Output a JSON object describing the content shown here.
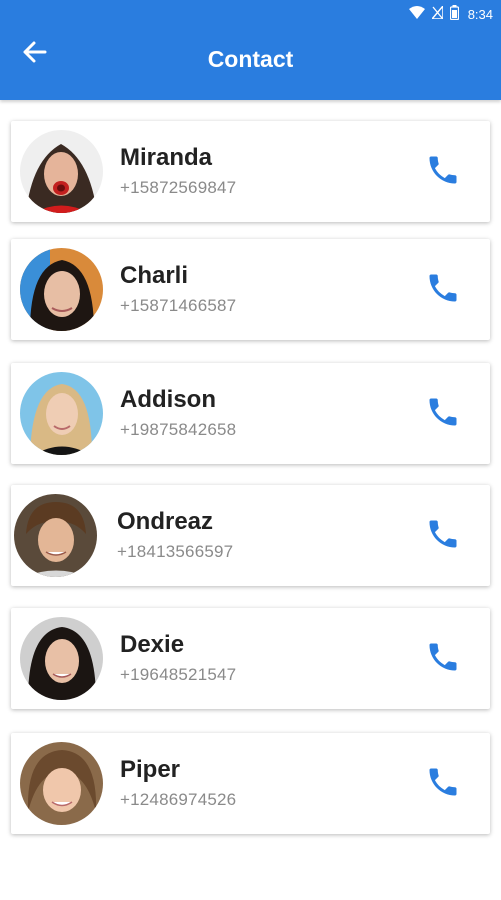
{
  "status_bar": {
    "time": "8:34",
    "icons": [
      "wifi-icon",
      "signal-icon",
      "battery-icon"
    ]
  },
  "app_bar": {
    "title": "Contact",
    "back_icon": "arrow-left-icon",
    "background_color": "#2a7ddf"
  },
  "contacts": [
    {
      "name": "Miranda",
      "phone": "+15872569847",
      "call_icon": "phone-icon"
    },
    {
      "name": "Charli",
      "phone": "+15871466587",
      "call_icon": "phone-icon"
    },
    {
      "name": "Addison",
      "phone": "+19875842658",
      "call_icon": "phone-icon"
    },
    {
      "name": "Ondreaz",
      "phone": "+18413566597",
      "call_icon": "phone-icon"
    },
    {
      "name": "Dexie",
      "phone": "+19648521547",
      "call_icon": "phone-icon"
    },
    {
      "name": "Piper",
      "phone": "+12486974526",
      "call_icon": "phone-icon"
    }
  ],
  "colors": {
    "accent": "#2a7ddf",
    "name_text": "#222222",
    "phone_text": "#8a8a8a"
  }
}
